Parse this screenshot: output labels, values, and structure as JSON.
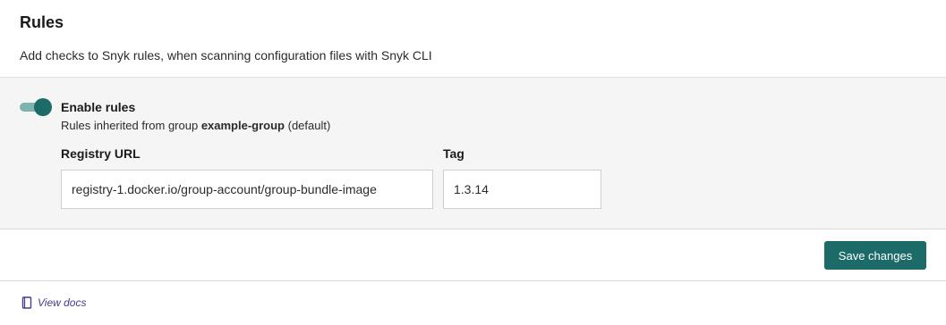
{
  "header": {
    "title": "Rules",
    "description": "Add checks to Snyk rules, when scanning configuration files with Snyk CLI"
  },
  "rules": {
    "toggle_label": "Enable rules",
    "toggle_enabled": true,
    "inherited_prefix": "Rules inherited from group ",
    "group_name": "example-group",
    "inherited_suffix": " (default)"
  },
  "form": {
    "registry_label": "Registry URL",
    "registry_value": "registry-1.docker.io/group-account/group-bundle-image",
    "tag_label": "Tag",
    "tag_value": "1.3.14"
  },
  "actions": {
    "save_label": "Save changes"
  },
  "footer": {
    "docs_label": "View docs",
    "docs_icon": "book-icon"
  },
  "colors": {
    "accent": "#1c6b69",
    "toggle_track": "#7fb3b0",
    "link": "#4b3a8f"
  }
}
